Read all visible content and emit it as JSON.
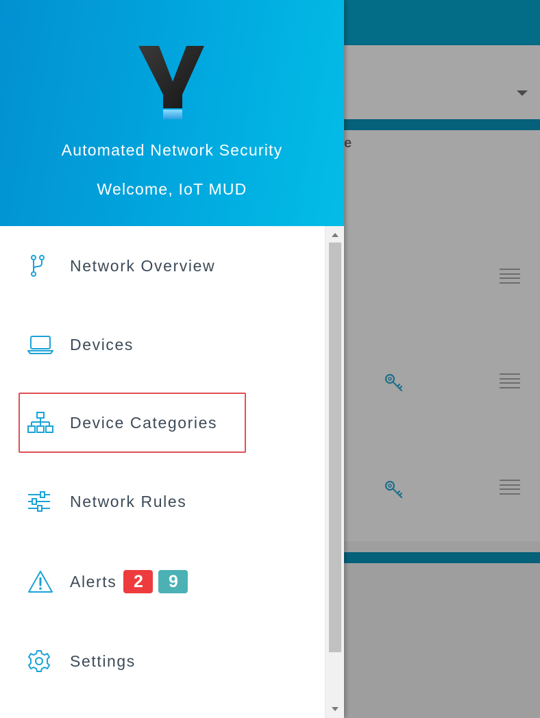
{
  "header": {
    "title": "Automated Network Security",
    "welcome": "Welcome, IoT MUD"
  },
  "menu": {
    "items": [
      {
        "label": "Network Overview",
        "icon": "network-branch-icon"
      },
      {
        "label": "Devices",
        "icon": "laptop-icon"
      },
      {
        "label": "Device Categories",
        "icon": "sitemap-icon"
      },
      {
        "label": "Network Rules",
        "icon": "sliders-icon"
      },
      {
        "label": "Alerts",
        "icon": "warning-icon"
      },
      {
        "label": "Settings",
        "icon": "gear-icon"
      }
    ],
    "alert_badges": {
      "critical": "2",
      "info": "9"
    }
  },
  "background": {
    "panel_heading_fragment": "e"
  },
  "colors": {
    "accent": "#0290d1",
    "icon": "#1aa3d8",
    "badge_red": "#ee3b3d",
    "badge_teal": "#4bb1b4",
    "highlight": "#e04f55"
  }
}
